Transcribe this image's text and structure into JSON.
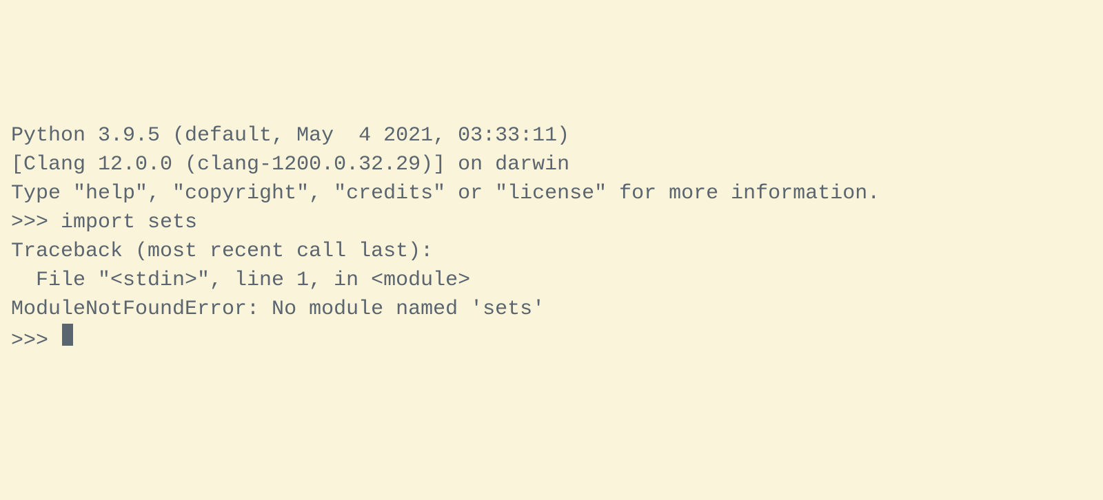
{
  "terminal": {
    "banner": {
      "version_line": "Python 3.9.5 (default, May  4 2021, 03:33:11) ",
      "compiler_line": "[Clang 12.0.0 (clang-1200.0.32.29)] on darwin",
      "help_line": "Type \"help\", \"copyright\", \"credits\" or \"license\" for more information."
    },
    "prompt": ">>> ",
    "input_1": "import sets",
    "traceback": {
      "header": "Traceback (most recent call last):",
      "file_line": "  File \"<stdin>\", line 1, in <module>",
      "error_line": "ModuleNotFoundError: No module named 'sets'"
    }
  }
}
